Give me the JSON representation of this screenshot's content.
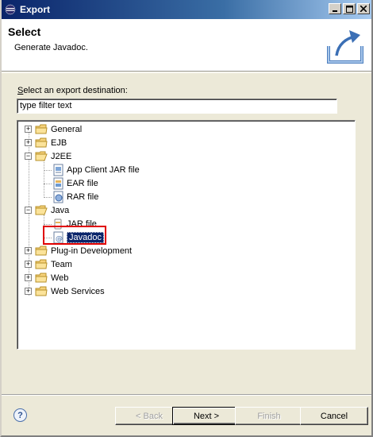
{
  "window": {
    "title": "Export"
  },
  "header": {
    "title": "Select",
    "description": "Generate Javadoc."
  },
  "destination": {
    "label_prefix": "",
    "label_mnemonic": "S",
    "label_rest": "elect an export destination:",
    "filter_placeholder": "type filter text",
    "filter_value": ""
  },
  "tree": {
    "general": "General",
    "ejb": "EJB",
    "j2ee": "J2EE",
    "app_client_jar": "App Client JAR file",
    "ear_file": "EAR file",
    "rar_file": "RAR file",
    "java": "Java",
    "jar_file": "JAR file",
    "javadoc": "Javadoc",
    "plugin_development": "Plug-in Development",
    "team": "Team",
    "web": "Web",
    "web_services": "Web Services"
  },
  "buttons": {
    "back": "< Back",
    "next": "Next >",
    "finish": "Finish",
    "cancel": "Cancel"
  },
  "colors": {
    "selection": "#0a246a",
    "highlight_box": "#e00000",
    "folder": "#f0c050"
  }
}
